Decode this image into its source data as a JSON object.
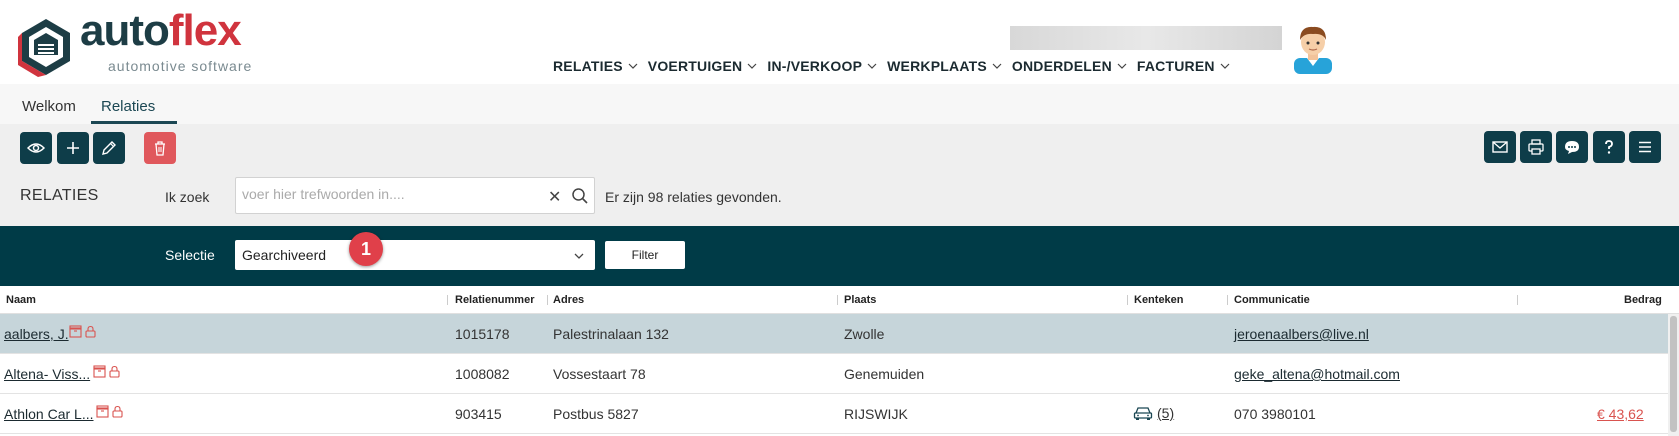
{
  "brand": {
    "word_auto": "auto",
    "word_flex": "flex",
    "tagline": "automotive software"
  },
  "nav": {
    "items": [
      {
        "label": "RELATIES"
      },
      {
        "label": "VOERTUIGEN"
      },
      {
        "label": "IN-/VERKOOP"
      },
      {
        "label": "WERKPLAATS"
      },
      {
        "label": "ONDERDELEN"
      },
      {
        "label": "FACTUREN"
      }
    ]
  },
  "tabs": [
    {
      "label": "Welkom",
      "active": false
    },
    {
      "label": "Relaties",
      "active": true
    }
  ],
  "toolbar": {
    "left_icons": [
      "eye-icon",
      "plus-icon",
      "pencil-icon",
      "trash-icon"
    ],
    "right_icons": [
      "mail-icon",
      "print-icon",
      "chat-icon",
      "help-icon",
      "menu-icon"
    ]
  },
  "page": {
    "title": "RELATIES",
    "search_label": "Ik zoek",
    "search_placeholder": "voer hier trefwoorden in....",
    "search_value": "",
    "clear_glyph": "✕",
    "result_text": "Er zijn 98 relaties gevonden."
  },
  "selection": {
    "label": "Selectie",
    "value": "Gearchiveerd",
    "marker": "1",
    "filter_label": "Filter"
  },
  "table": {
    "headers": {
      "naam": "Naam",
      "relatienummer": "Relatienummer",
      "adres": "Adres",
      "plaats": "Plaats",
      "kenteken": "Kenteken",
      "communicatie": "Communicatie",
      "bedrag": "Bedrag"
    },
    "rows": [
      {
        "naam": "aalbers, J.",
        "relatienummer": "1015178",
        "adres": "Palestrinalaan 132",
        "plaats": "Zwolle",
        "kenteken": "",
        "communicatie": "jeroenaalbers@live.nl",
        "bedrag": "",
        "selected": true
      },
      {
        "naam": "Altena- Viss...",
        "relatienummer": "1008082",
        "adres": "Vossestaart 78",
        "plaats": "Genemuiden",
        "kenteken": "",
        "communicatie": "geke_altena@hotmail.com",
        "bedrag": "",
        "selected": false
      },
      {
        "naam": "Athlon Car L...",
        "relatienummer": "903415",
        "adres": "Postbus 5827",
        "plaats": "RIJSWIJK",
        "kenteken": "(5)",
        "communicatie": "070 3980101",
        "bedrag": "€ 43,62",
        "selected": false
      }
    ]
  },
  "colors": {
    "primary": "#003b47",
    "accent": "#d0343e",
    "danger": "#e0585c",
    "selected_row": "#c6d5da"
  }
}
